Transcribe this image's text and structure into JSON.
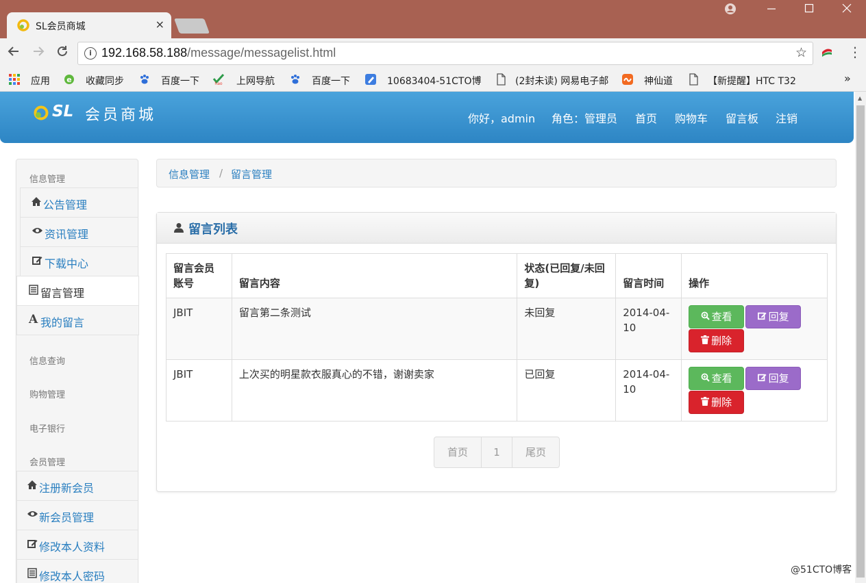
{
  "browser": {
    "tab_title": "SL会员商城",
    "tab_close": "×",
    "url_host": "192.168.58.188",
    "url_path": "/message/messagelist.html",
    "bookmarks": [
      "应用",
      "收藏同步",
      "百度一下",
      "上网导航",
      "百度一下",
      "10683404-51CTO博",
      "(2封未读) 网易电子邮",
      "神仙道",
      "【新提醒】HTC T32"
    ],
    "more": "»"
  },
  "header": {
    "logo_sl": "SL",
    "logo_name": "会员商城",
    "nav": [
      "你好，admin",
      "角色：管理员",
      "首页",
      "购物车",
      "留言板",
      "注销"
    ]
  },
  "sidebar": {
    "sections": [
      "信息管理",
      "信息查询",
      "购物管理",
      "电子银行",
      "会员管理"
    ],
    "info_items": [
      "公告管理",
      "资讯管理",
      "下载中心",
      "留言管理",
      "我的留言"
    ],
    "member_items": [
      "注册新会员",
      "新会员管理",
      "修改本人资料",
      "修改本人密码"
    ]
  },
  "breadcrumb": {
    "level1": "信息管理",
    "separator": "/",
    "level2": "留言管理"
  },
  "panel": {
    "title": "留言列表",
    "columns": [
      "留言会员账号",
      "留言内容",
      "状态(已回复/未回复)",
      "留言时间",
      "操作"
    ],
    "rows": [
      {
        "account": "JBIT",
        "content": "留言第二条测试",
        "status": "未回复",
        "time": "2014-04-10"
      },
      {
        "account": "JBIT",
        "content": "上次买的明星款衣服真心的不错，谢谢卖家",
        "status": "已回复",
        "time": "2014-04-10"
      }
    ],
    "actions": {
      "view": "查看",
      "reply": "回复",
      "delete": "删除"
    }
  },
  "pagination": {
    "first": "首页",
    "current": "1",
    "last": "尾页"
  },
  "watermark": "@51CTO博客",
  "colors": {
    "header_blue": "#3a95d3",
    "link_blue": "#2a7fc0",
    "success": "#5cb85c",
    "purple": "#9b6bc9",
    "danger": "#d9232c",
    "titlebar": "#a86152"
  }
}
